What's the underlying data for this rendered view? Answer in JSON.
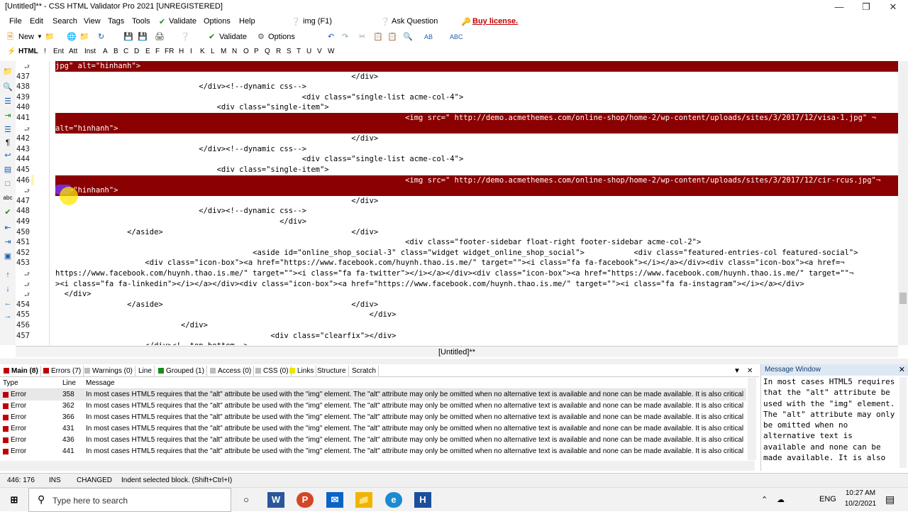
{
  "window": {
    "title": "[Untitled]** - CSS HTML Validator Pro 2021 [UNREGISTERED]"
  },
  "menu": [
    "File",
    "Edit",
    "Search",
    "View",
    "Tags",
    "Tools",
    "Validate",
    "Options",
    "Help",
    "img (F1)",
    "Ask Question",
    "Buy license."
  ],
  "toolbar": {
    "new": "New",
    "validate": "Validate",
    "options": "Options"
  },
  "tagbar": [
    "HTML",
    "!",
    "Ent",
    "Att",
    "Inst",
    "A",
    "B",
    "C",
    "D",
    "E",
    "F",
    "FR",
    "H",
    "I",
    "K",
    "L",
    "M",
    "N",
    "O",
    "P",
    "Q",
    "R",
    "S",
    "T",
    "U",
    "V",
    "W"
  ],
  "editor": {
    "lines": [
      {
        "no": "",
        "wrap": true,
        "text": "jpg\" alt=\"hinhanh\">",
        "hl": true
      },
      {
        "no": "437",
        "text": "                                                                  </div>"
      },
      {
        "no": "438",
        "text": "                                </div><!--dynamic css-->"
      },
      {
        "no": "439",
        "text": "                                                       <div class=\"single-list acme-col-4\">"
      },
      {
        "no": "440",
        "text": "                                    <div class=\"single-item\">"
      },
      {
        "no": "441",
        "text": "                                                                              <img src=\" http://demo.acmethemes.com/online-shop/home-2/wp-content/uploads/sites/3/2017/12/visa-1.jpg\" ¬",
        "hl": true
      },
      {
        "no": "",
        "wrap": true,
        "text": "alt=\"hinhanh\">",
        "hl": true
      },
      {
        "no": "442",
        "text": "                                                                  </div>"
      },
      {
        "no": "443",
        "text": "                                </div><!--dynamic css-->"
      },
      {
        "no": "444",
        "text": "                                                       <div class=\"single-list acme-col-4\">"
      },
      {
        "no": "445",
        "text": "                                    <div class=\"single-item\">"
      },
      {
        "no": "446",
        "text": "                                                                              <img src=\" http://demo.acmethemes.com/online-shop/home-2/wp-content/uploads/sites/3/2017/12/cir-rcus.jpg\"¬",
        "hl": true
      },
      {
        "no": "",
        "wrap": true,
        "text": "alt=\"hinhanh\">",
        "hl": true
      },
      {
        "no": "447",
        "text": "                                                                  </div>"
      },
      {
        "no": "448",
        "text": "                                </div><!--dynamic css-->"
      },
      {
        "no": "449",
        "text": "                                                  </div>"
      },
      {
        "no": "450",
        "text": "                </aside>                                          </div>"
      },
      {
        "no": "451",
        "text": "                                                                              <div class=\"footer-sidebar float-right footer-sidebar acme-col-2\">"
      },
      {
        "no": "452",
        "text": "                                            <aside id=\"online_shop_social-3\" class=\"widget widget_online_shop_social\">           <div class=\"featured-entries-col featured-social\">"
      },
      {
        "no": "453",
        "text": "                    <div class=\"icon-box\"><a href=\"https://www.facebook.com/huynh.thao.is.me/\" target=\"\"><i class=\"fa fa-facebook\"></i></a></div><div class=\"icon-box\"><a href=¬"
      },
      {
        "no": "",
        "wrap": true,
        "text": "https://www.facebook.com/huynh.thao.is.me/\" target=\"\"><i class=\"fa fa-twitter\"></i></a></div><div class=\"icon-box\"><a href=\"https://www.facebook.com/huynh.thao.is.me/\" target=\"\"¬"
      },
      {
        "no": "",
        "wrap": true,
        "text": "><i class=\"fa fa-linkedin\"></i></a></div><div class=\"icon-box\"><a href=\"https://www.facebook.com/huynh.thao.is.me/\" target=\"\"><i class=\"fa fa-instagram\"></i></a></div>"
      },
      {
        "no": "",
        "wrap": true,
        "text": "  </div>"
      },
      {
        "no": "454",
        "text": "                </aside>                                          </div>"
      },
      {
        "no": "455",
        "text": "                                                                      </div>"
      },
      {
        "no": "456",
        "text": "                            </div>"
      },
      {
        "no": "457",
        "text": "                                                <div class=\"clearfix\"></div>"
      },
      {
        "no": "",
        "text": "                    </div><!--top-bottom-->"
      }
    ]
  },
  "doc_tab": "[Untitled]**",
  "msg_tabs": [
    "Main (8)",
    "Errors (7)",
    "Warnings (0)",
    "Line",
    "Grouped (1)",
    "Access (0)",
    "CSS (0)",
    "Links",
    "Structure",
    "Scratch"
  ],
  "msg_headers": {
    "type": "Type",
    "line": "Line",
    "message": "Message"
  },
  "messages": [
    {
      "type": "Error",
      "line": "358",
      "msg": "In most cases HTML5 requires that the \"alt\" attribute be used with the \"img\" element. The \"alt\" attribute may only be omitted when no alternative text is available and none can be made available. It is also critical"
    },
    {
      "type": "Error",
      "line": "362",
      "msg": "In most cases HTML5 requires that the \"alt\" attribute be used with the \"img\" element. The \"alt\" attribute may only be omitted when no alternative text is available and none can be made available. It is also critical"
    },
    {
      "type": "Error",
      "line": "366",
      "msg": "In most cases HTML5 requires that the \"alt\" attribute be used with the \"img\" element. The \"alt\" attribute may only be omitted when no alternative text is available and none can be made available. It is also critical"
    },
    {
      "type": "Error",
      "line": "431",
      "msg": "In most cases HTML5 requires that the \"alt\" attribute be used with the \"img\" element. The \"alt\" attribute may only be omitted when no alternative text is available and none can be made available. It is also critical"
    },
    {
      "type": "Error",
      "line": "436",
      "msg": "In most cases HTML5 requires that the \"alt\" attribute be used with the \"img\" element. The \"alt\" attribute may only be omitted when no alternative text is available and none can be made available. It is also critical"
    },
    {
      "type": "Error",
      "line": "441",
      "msg": "In most cases HTML5 requires that the \"alt\" attribute be used with the \"img\" element. The \"alt\" attribute may only be omitted when no alternative text is available and none can be made available. It is also critical"
    }
  ],
  "message_window": {
    "title": "Message Window",
    "text": "In most cases HTML5 requires that the \"alt\" attribute be used with the \"img\" element. The \"alt\" attribute may only be omitted when no alternative text is available and none can be made available. It is also"
  },
  "status": {
    "pos": "446: 176",
    "mode": "INS",
    "changed": "CHANGED",
    "hint": "Indent selected block. (Shift+Ctrl+I)"
  },
  "taskbar": {
    "search_placeholder": "Type here to search",
    "lang": "ENG",
    "time": "10:27 AM",
    "date": "10/2/2021"
  },
  "colors": {
    "highlight": "#8b0000",
    "accent": "#1a5fb4",
    "buy": "#c00000"
  }
}
